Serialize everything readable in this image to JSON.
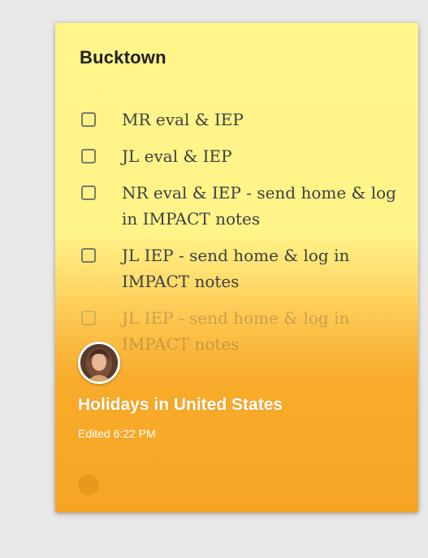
{
  "note": {
    "title": "Bucktown",
    "items": [
      {
        "text": "MR eval & IEP",
        "checked": false
      },
      {
        "text": "JL eval & IEP",
        "checked": false
      },
      {
        "text": "NR eval & IEP - send home & log in IMPACT notes",
        "checked": false
      },
      {
        "text": "JL IEP - send home & log in IMPACT notes",
        "checked": false
      },
      {
        "text": "JL IEP - send home & log in IMPACT notes",
        "checked": false
      }
    ],
    "event_title": "Holidays in United States",
    "edited_label": "Edited 6:22 PM",
    "background_colors": [
      "#fff58a",
      "#f6a523"
    ]
  }
}
